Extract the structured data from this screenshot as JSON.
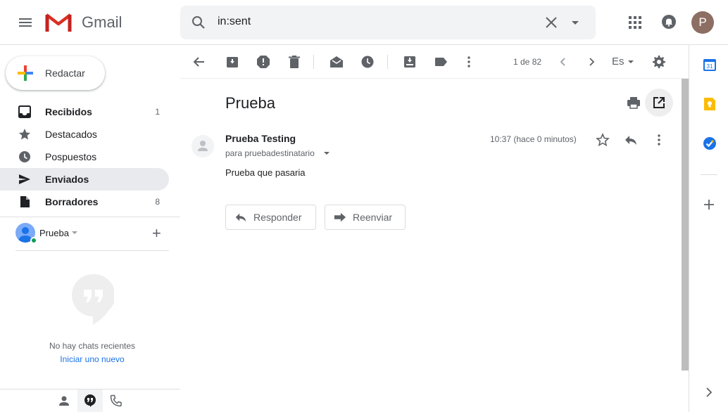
{
  "app": {
    "logo_word": "Gmail",
    "avatar_letter": "P"
  },
  "search": {
    "value": "in:sent"
  },
  "compose": {
    "label": "Redactar"
  },
  "nav": [
    {
      "label": "Recibidos",
      "count": "1",
      "bold": true,
      "icon": "inbox-icon"
    },
    {
      "label": "Destacados",
      "count": "",
      "bold": false,
      "icon": "star-icon"
    },
    {
      "label": "Pospuestos",
      "count": "",
      "bold": false,
      "icon": "clock-icon"
    },
    {
      "label": "Enviados",
      "count": "",
      "bold": true,
      "icon": "send-icon",
      "active": true
    },
    {
      "label": "Borradores",
      "count": "8",
      "bold": true,
      "icon": "draft-icon"
    }
  ],
  "hangouts": {
    "user_name": "Prueba",
    "no_chats": "No hay chats recientes",
    "start_new": "Iniciar uno nuevo"
  },
  "toolbar": {
    "pager": "1 de 82",
    "language": "Es"
  },
  "email": {
    "subject": "Prueba",
    "sender": "Prueba Testing",
    "recipient": "para pruebadestinatario",
    "time": "10:37 (hace 0 minutos)",
    "body": "Prueba que pasaria"
  },
  "actions": {
    "reply": "Responder",
    "forward": "Reenviar"
  },
  "colors": {
    "accent": "#1a73e8",
    "online": "#0f9d58",
    "avatar": "#8d6e63"
  }
}
